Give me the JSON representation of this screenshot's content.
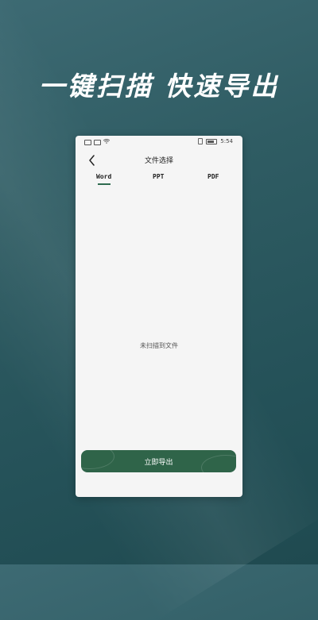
{
  "promo": {
    "headline": "一键扫描 快速导出"
  },
  "statusbar": {
    "time": "5:54"
  },
  "header": {
    "title": "文件选择",
    "back_icon": "chevron-left-icon"
  },
  "tabs": [
    {
      "label": "Word",
      "active": true
    },
    {
      "label": "PPT",
      "active": false
    },
    {
      "label": "PDF",
      "active": false
    }
  ],
  "main": {
    "empty_text": "未扫描到文件"
  },
  "footer": {
    "export_label": "立即导出"
  },
  "colors": {
    "accent": "#2f6449",
    "background": "#2f5c63"
  }
}
